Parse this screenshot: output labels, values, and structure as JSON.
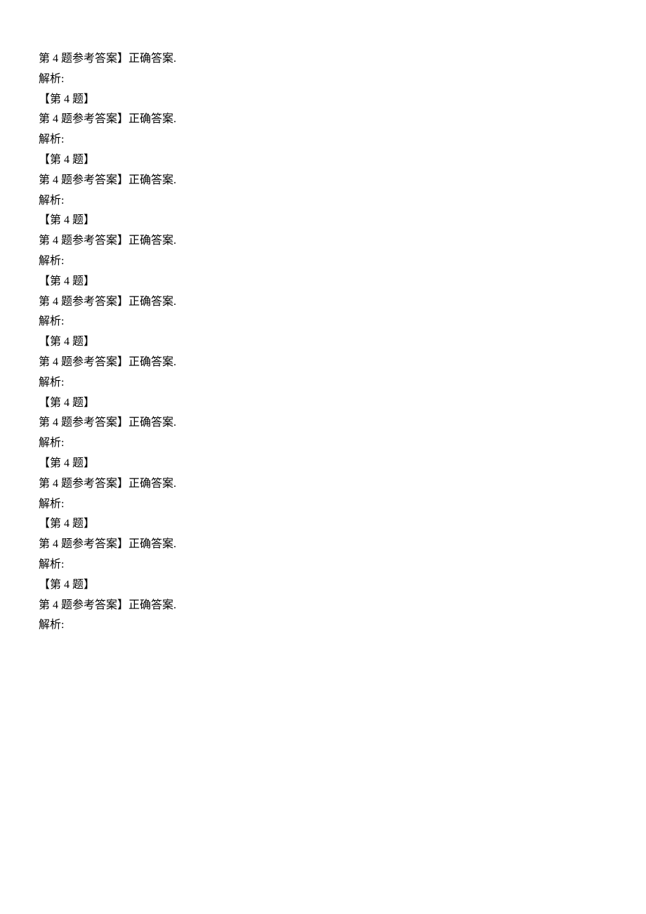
{
  "blocks": [
    {
      "answer_line": "第 4 题参考答案】正确答案.",
      "analysis_line": "解析:",
      "header_line": "【第 4 题】"
    },
    {
      "answer_line": "第 4 题参考答案】正确答案.",
      "analysis_line": "解析:",
      "header_line": "【第 4 题】"
    },
    {
      "answer_line": "第 4 题参考答案】正确答案.",
      "analysis_line": "解析:",
      "header_line": "【第 4 题】"
    },
    {
      "answer_line": "第 4 题参考答案】正确答案.",
      "analysis_line": "解析:",
      "header_line": "【第 4 题】"
    },
    {
      "answer_line": "第 4 题参考答案】正确答案.",
      "analysis_line": "解析:",
      "header_line": "【第 4 题】"
    },
    {
      "answer_line": "第 4 题参考答案】正确答案.",
      "analysis_line": "解析:",
      "header_line": "【第 4 题】"
    },
    {
      "answer_line": "第 4 题参考答案】正确答案.",
      "analysis_line": "解析:",
      "header_line": "【第 4 题】"
    },
    {
      "answer_line": "第 4 题参考答案】正确答案.",
      "analysis_line": "解析:",
      "header_line": "【第 4 题】"
    },
    {
      "answer_line": "第 4 题参考答案】正确答案.",
      "analysis_line": "解析:",
      "header_line": "【第 4 题】"
    },
    {
      "answer_line": "第 4 题参考答案】正确答案.",
      "analysis_line": "解析:",
      "header_line": null
    }
  ]
}
